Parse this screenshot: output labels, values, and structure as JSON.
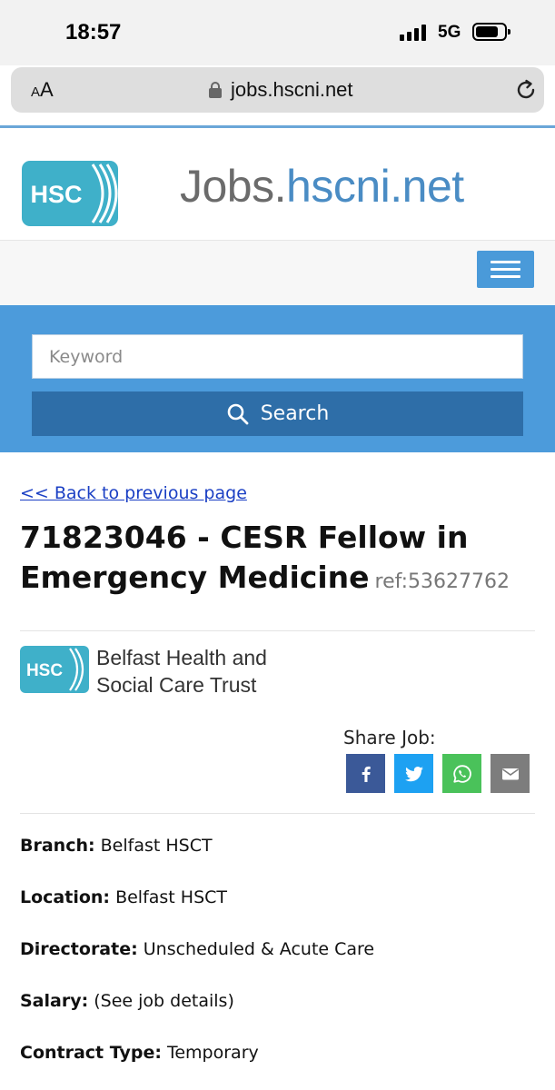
{
  "status_bar": {
    "time": "18:57",
    "network": "5G",
    "icons": [
      "signal-icon",
      "battery-icon"
    ]
  },
  "browser": {
    "text_size_button": {
      "small": "A",
      "large": "A"
    },
    "url": "jobs.hscni.net",
    "icons": [
      "lock-icon",
      "reload-icon"
    ]
  },
  "header": {
    "logo_text": "HSC",
    "site_title_part1": "Jobs.",
    "site_title_part2": "hscni.net",
    "menu_icon": "hamburger-menu-icon"
  },
  "search": {
    "keyword_placeholder": "Keyword",
    "keyword_value": "",
    "button_label": "Search"
  },
  "job": {
    "back_link": "<< Back to previous page",
    "title": "71823046 - CESR Fellow in Emergency Medicine",
    "ref": "ref:53627762",
    "employer_logo_text": "HSC",
    "employer_line1": "Belfast Health and",
    "employer_line2": "Social Care Trust",
    "share_label": "Share Job:",
    "share_buttons": [
      "facebook-icon",
      "twitter-icon",
      "whatsapp-icon",
      "email-icon"
    ],
    "details": [
      {
        "key": "Branch:",
        "value": "Belfast HSCT"
      },
      {
        "key": "Location:",
        "value": "Belfast HSCT"
      },
      {
        "key": "Directorate:",
        "value": "Unscheduled & Acute Care"
      },
      {
        "key": "Salary:",
        "value": "(See job details)"
      },
      {
        "key": "Contract Type:",
        "value": "Temporary"
      }
    ]
  },
  "colors": {
    "accent_blue": "#4c9bdb",
    "search_button": "#2e6ea8",
    "link": "#1a3fc4",
    "logo_teal": "#3fb0c9",
    "facebook": "#3b5998",
    "twitter": "#1da1f2",
    "whatsapp": "#4ac25a",
    "email": "#7d7d7d"
  }
}
